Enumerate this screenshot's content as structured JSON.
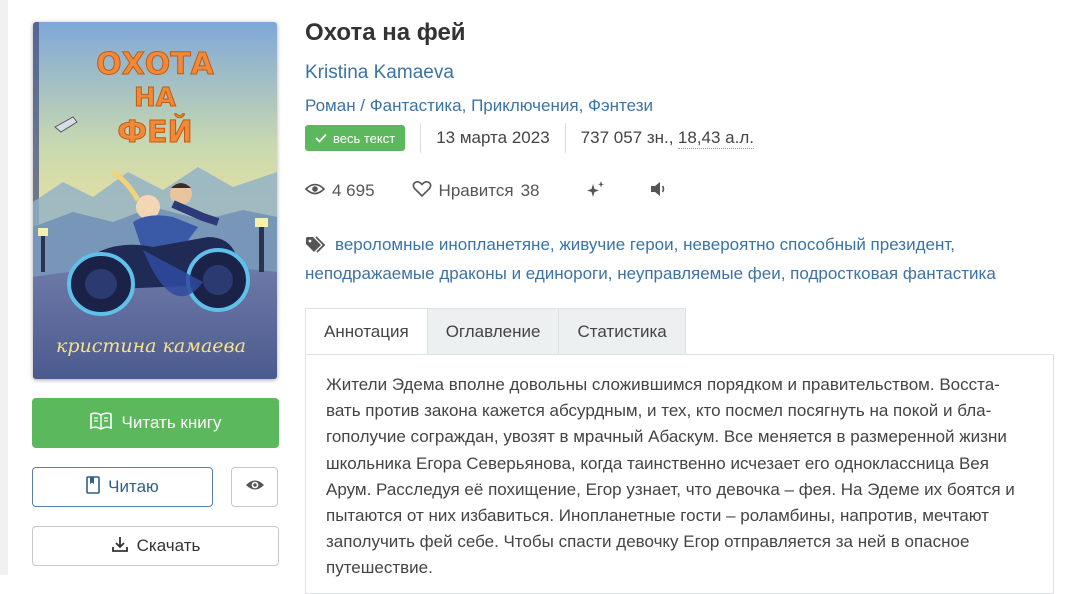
{
  "book": {
    "title": "Охота на фей",
    "author": "Kristina Kamaeva",
    "genre_main": "Роман",
    "genre_sep": " / ",
    "genres": [
      "Фантастика",
      "Приключения",
      "Фэнтези"
    ],
    "badge": "весь текст",
    "date": "13 марта 2023",
    "size_chars": "737 057 зн.,",
    "size_al": "18,43 а.л."
  },
  "stats": {
    "views": "4 695",
    "likes_label": "Нравится",
    "likes": "38"
  },
  "tags": [
    "вероломные инопланетяне",
    "живучие герои",
    "невероятно способный президент",
    "неподражаемые драконы и единороги",
    "неуправляемые феи",
    "подростковая фантастика"
  ],
  "cover": {
    "title_line1": "ОХОТА",
    "title_line2": "НА",
    "title_line3": "ФЕЙ",
    "author_text": "кристина камаева"
  },
  "buttons": {
    "read": "Читать книгу",
    "reading": "Читаю",
    "download": "Скачать"
  },
  "tabs": [
    "Аннотация",
    "Оглавление",
    "Статистика"
  ],
  "annotation": "Жители Эдема вполне довольны сложившимся порядком и правительством. Восста-\nвать против закона кажется абсурдным, и тех, кто посмел посягнуть на покой и бла-\nгополучие сограждан, увозят в мрачный Абаскум. Все меняется в размеренной жизни\nшкольника Егора Северьянова, когда таинственно исчезает его одноклассница Вея\nАрум. Расследуя её похищение, Егор узнает, что девочка – фея. На Эдеме их боятся и\nпытаются от них избавиться. Инопланетные гости – роламбины, напротив, мечтают\nзаполучить фей себе. Чтобы спасти девочку Егор отправляется за ней в опасное\nпутешествие.",
  "colors": {
    "accent_green": "#5cb85c",
    "link_blue": "#3b73a5"
  }
}
